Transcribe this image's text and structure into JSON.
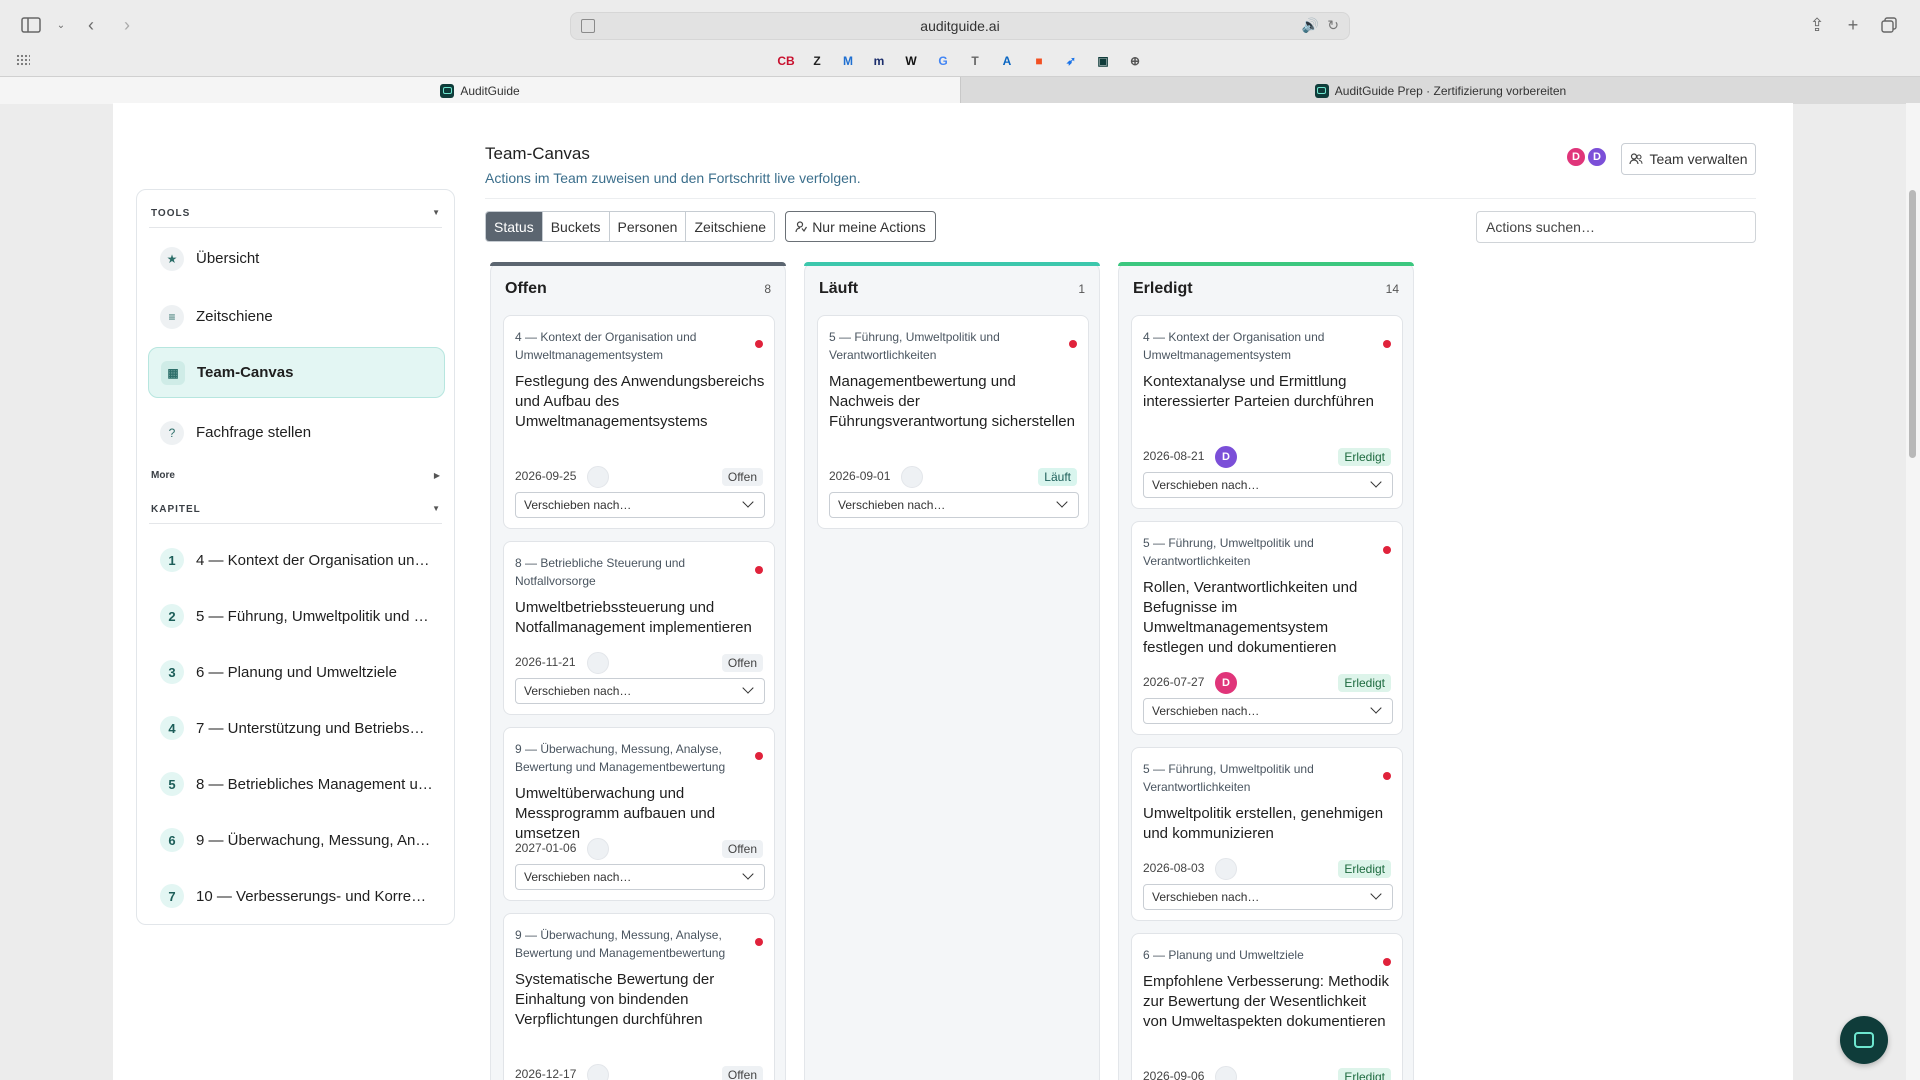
{
  "browser": {
    "url": "auditguide.ai",
    "tabs": [
      {
        "title": "AuditGuide"
      },
      {
        "title": "AuditGuide Prep · Zertifizierung vorbereiten"
      }
    ],
    "bookmarks": [
      {
        "glyph": "CB",
        "color": "#c8102e"
      },
      {
        "glyph": "Z",
        "color": "#222222"
      },
      {
        "glyph": "M",
        "color": "#1f6fd1"
      },
      {
        "glyph": "m",
        "color": "#1b2d6b"
      },
      {
        "glyph": "W",
        "color": "#111111"
      },
      {
        "glyph": "G",
        "color": "#4285f4"
      },
      {
        "glyph": "T",
        "color": "#666666"
      },
      {
        "glyph": "A",
        "color": "#0a66c2"
      },
      {
        "glyph": "■",
        "color": "#f25022"
      },
      {
        "glyph": "➶",
        "color": "#1a73e8"
      },
      {
        "glyph": "▣",
        "color": "#0f3c3a"
      },
      {
        "glyph": "⊕",
        "color": "#555555"
      }
    ]
  },
  "sidebar": {
    "tools_heading": "TOOLS",
    "tools": [
      {
        "label": "Übersicht",
        "icon": "★"
      },
      {
        "label": "Zeitschiene",
        "icon": "≡"
      },
      {
        "label": "Team-Canvas",
        "icon": "▦",
        "active": true
      },
      {
        "label": "Fachfrage stellen",
        "icon": "?"
      }
    ],
    "more_label": "More",
    "chapters_heading": "KAPITEL",
    "chapters": [
      {
        "num": "1",
        "label": "4 — Kontext der Organisation und …"
      },
      {
        "num": "2",
        "label": "5 — Führung, Umweltpolitik und Ve…"
      },
      {
        "num": "3",
        "label": "6 — Planung und Umweltziele"
      },
      {
        "num": "4",
        "label": "7 — Unterstützung und Betriebsmit…"
      },
      {
        "num": "5",
        "label": "8 — Betriebliches Management un…"
      },
      {
        "num": "6",
        "label": "9 — Überwachung, Messung, Analy…"
      },
      {
        "num": "7",
        "label": "10 — Verbesserungs- und Korrektu…"
      }
    ]
  },
  "header": {
    "title": "Team-Canvas",
    "subtitle": "Actions im Team zuweisen und den Fortschritt live verfolgen.",
    "avatars": [
      {
        "initial": "D",
        "color": "#e0357a"
      },
      {
        "initial": "D",
        "color": "#7b4fd8"
      }
    ],
    "manage_team_label": "Team verwalten"
  },
  "toolbar": {
    "views": [
      "Status",
      "Buckets",
      "Personen",
      "Zeitschiene"
    ],
    "active_view": "Status",
    "my_actions_label": "Nur meine Actions",
    "search_placeholder": "Actions suchen…"
  },
  "colors": {
    "open": "#5b6570",
    "running": "#3cc7ac",
    "done": "#3cc77f",
    "accent": "#0f3c3a"
  },
  "move_label": "Verschieben nach…",
  "columns": [
    {
      "title": "Offen",
      "count": "8",
      "cards": [
        {
          "chapter": "4 — Kontext der Organisation und Umweltmanagementsystem",
          "title": "Festlegung des Anwendungsbereichs und Aufbau des Umweltmanagementsystems",
          "date": "2026-09-25",
          "status": "Offen"
        },
        {
          "chapter": "8 — Betriebliche Steuerung und Notfallvorsorge",
          "title": "Umweltbetriebssteuerung und Notfallmanagement implementieren",
          "date": "2026-11-21",
          "status": "Offen"
        },
        {
          "chapter": "9 — Überwachung, Messung, Analyse, Bewertung und Managementbewertung",
          "title": "Umweltüberwachung und Messprogramm aufbauen und umsetzen",
          "date": "2027-01-06",
          "status": "Offen"
        },
        {
          "chapter": "9 — Überwachung, Messung, Analyse, Bewertung und Managementbewertung",
          "title": "Systematische Bewertung der Einhaltung von bindenden Verpflichtungen durchführen",
          "date": "2026-12-17",
          "status": "Offen"
        }
      ]
    },
    {
      "title": "Läuft",
      "count": "1",
      "cards": [
        {
          "chapter": "5 — Führung, Umweltpolitik und Verantwortlichkeiten",
          "title": "Managementbewertung und Nachweis der Führungsverantwortung sicherstellen",
          "date": "2026-09-01",
          "status": "Läuft"
        }
      ]
    },
    {
      "title": "Erledigt",
      "count": "14",
      "cards": [
        {
          "chapter": "4 — Kontext der Organisation und Umweltmanagementsystem",
          "title": "Kontextanalyse und Ermittlung interessierter Parteien durchführen",
          "date": "2026-08-21",
          "status": "Erledigt",
          "assignee": "D",
          "assignee_color": "#7b4fd8"
        },
        {
          "chapter": "5 — Führung, Umweltpolitik und Verantwortlichkeiten",
          "title": "Rollen, Verantwortlichkeiten und Befugnisse im Umweltmanagementsystem festlegen und dokumentieren",
          "date": "2026-07-27",
          "status": "Erledigt",
          "assignee": "D",
          "assignee_color": "#e0357a"
        },
        {
          "chapter": "5 — Führung, Umweltpolitik und Verantwortlichkeiten",
          "title": "Umweltpolitik erstellen, genehmigen und kommunizieren",
          "date": "2026-08-03",
          "status": "Erledigt"
        },
        {
          "chapter": "6 — Planung und Umweltziele",
          "title": "Empfohlene Verbesserung: Methodik zur Bewertung der Wesentlichkeit von Umweltaspekten dokumentieren",
          "date": "2026-09-06",
          "status": "Erledigt"
        }
      ]
    }
  ]
}
